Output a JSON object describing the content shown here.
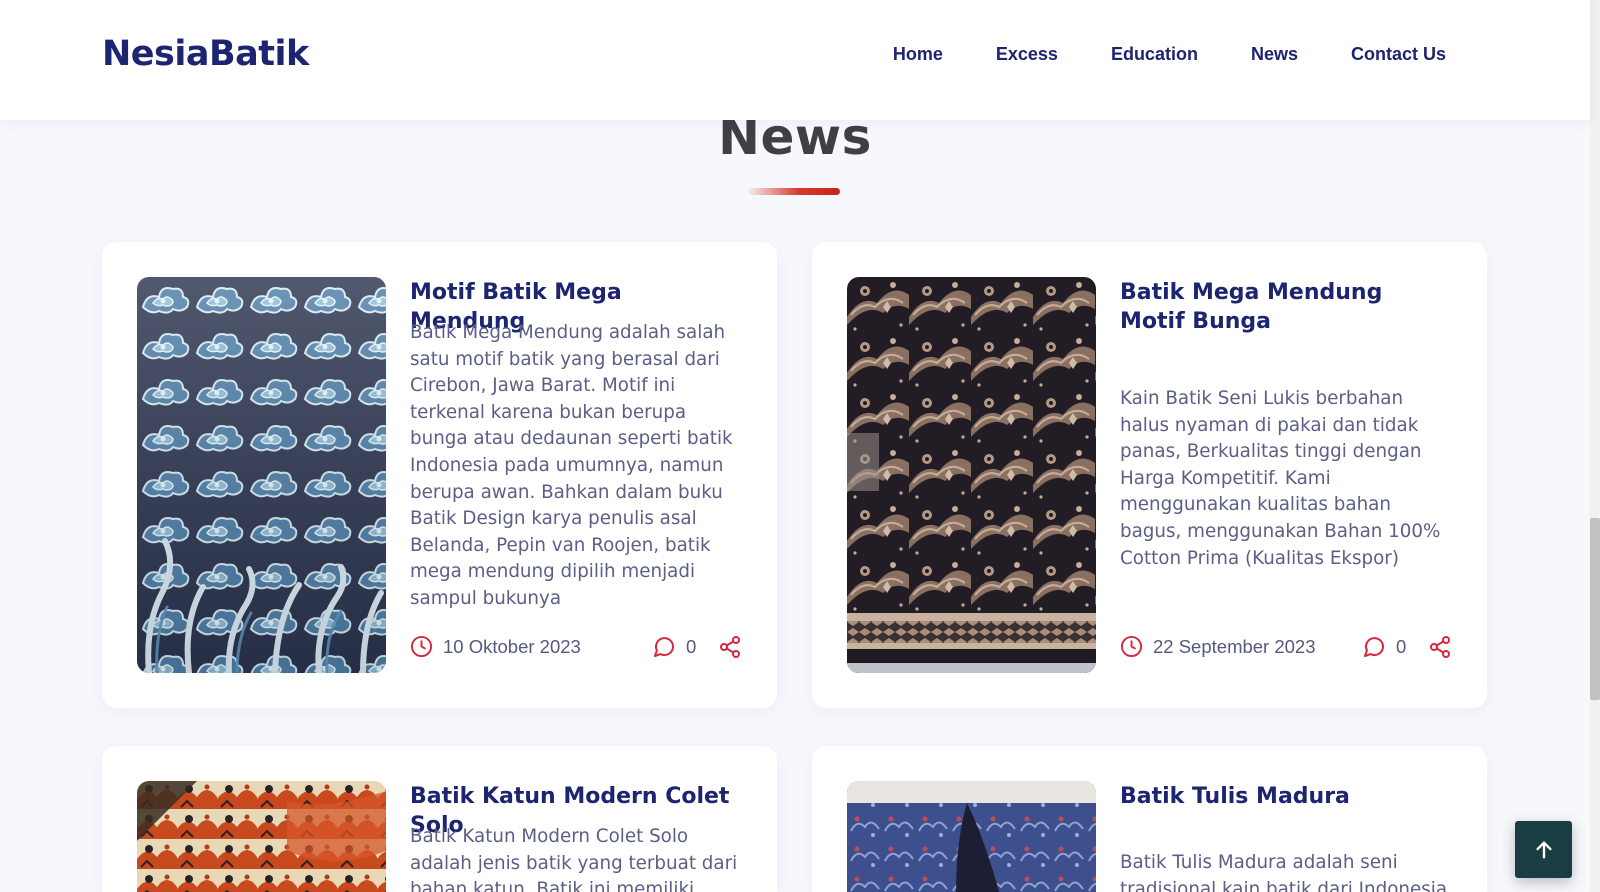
{
  "header": {
    "logo": "NesiaBatik",
    "nav": [
      "Home",
      "Excess",
      "Education",
      "News",
      "Contact Us"
    ]
  },
  "section": {
    "title": "News"
  },
  "articles": [
    {
      "title": "Motif Batik Mega Mendung",
      "description": "Batik Mega Mendung adalah salah satu motif batik yang berasal dari Cirebon, Jawa Barat. Motif ini terkenal karena bukan berupa bunga atau dedaunan seperti batik Indonesia pada umumnya, namun berupa awan. Bahkan dalam buku Batik Design karya penulis asal Belanda, Pepin van Roojen, batik mega mendung dipilih menjadi sampul bukunya",
      "date": "10 Oktober 2023",
      "comments": "0"
    },
    {
      "title": "Batik Mega Mendung Motif Bunga",
      "description": "Kain Batik Seni Lukis berbahan halus nyaman di pakai dan tidak panas, Berkualitas tinggi dengan Harga Kompetitif. Kami menggunakan kualitas bahan bagus, menggunakan Bahan 100% Cotton Prima (Kualitas Ekspor)",
      "date": "22 September 2023",
      "comments": "0"
    },
    {
      "title": "Batik Katun Modern Colet Solo",
      "description": "Batik Katun Modern Colet Solo adalah jenis batik yang terbuat dari bahan katun. Batik ini memiliki warna"
    },
    {
      "title": "Batik Tulis Madura",
      "description": "Batik Tulis Madura adalah seni tradisional kain batik dari Indonesia"
    }
  ],
  "icons": {
    "clock": "clock-icon",
    "comment": "comment-icon",
    "share": "share-icon",
    "back_to_top": "arrow-up-icon"
  },
  "colors": {
    "brand_navy": "#1d2470",
    "accent_red": "#d7263d",
    "text_muted": "#5b5f86",
    "back_to_top_bg": "#193d42",
    "page_bg": "#f7f8fc"
  }
}
